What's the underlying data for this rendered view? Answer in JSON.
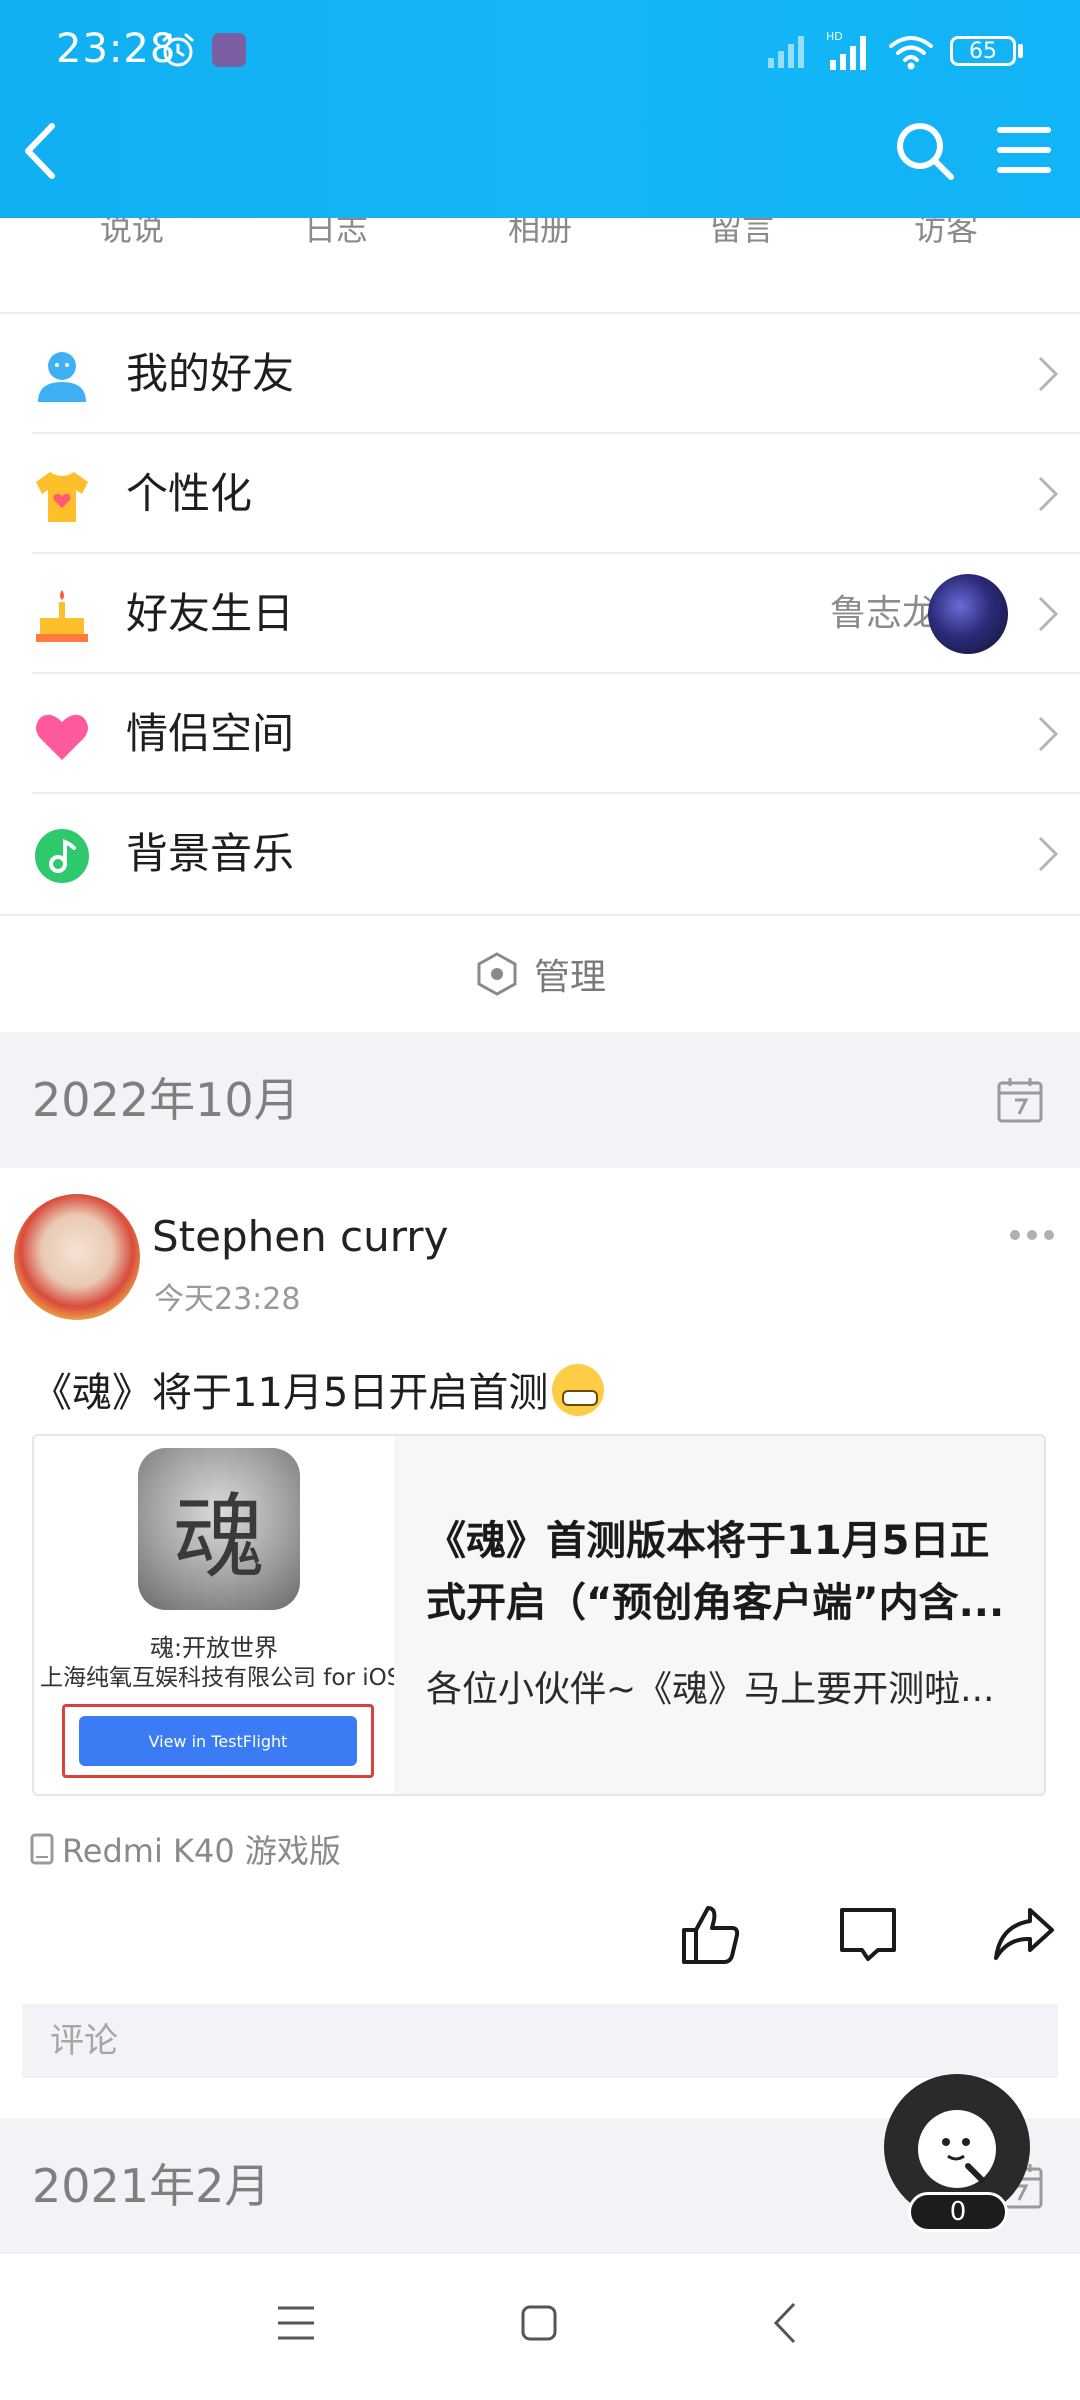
{
  "status_bar": {
    "time": "23:28",
    "hd_label": "HD",
    "battery": "65"
  },
  "stats": [
    {
      "value": "",
      "label": "说说"
    },
    {
      "value": "",
      "label": "日志"
    },
    {
      "value": "",
      "label": "相册"
    },
    {
      "value": "",
      "label": "留言"
    },
    {
      "value": "",
      "label": "访客"
    }
  ],
  "menu": {
    "items": [
      {
        "label": "我的好友",
        "icon": "friends-icon",
        "color": "#3fb0f4"
      },
      {
        "label": "个性化",
        "icon": "tshirt-icon",
        "color": "#ffbf2b"
      },
      {
        "label": "好友生日",
        "icon": "birthday-cake-icon",
        "color": "#ff9a1f",
        "extra": "鲁志龙"
      },
      {
        "label": "情侣空间",
        "icon": "heart-icon",
        "color": "#ff5a9e"
      },
      {
        "label": "背景音乐",
        "icon": "music-icon",
        "color": "#2ec96d"
      }
    ],
    "manage_label": "管理"
  },
  "sections": [
    {
      "title": "2022年10月"
    },
    {
      "title": "2021年2月"
    }
  ],
  "post": {
    "author": "Stephen curry",
    "time": "今天23:28",
    "text": "《魂》将于11月5日开启首测",
    "share": {
      "logo_char": "魂",
      "app_name": "魂:开放世界",
      "company": "上海纯氧互娱科技有限公司 for iOS",
      "button": "View in TestFlight",
      "title": "《魂》首测版本将于11月5日正式开启（“预创角客户端”内含...",
      "desc": "各位小伙伴~《魂》马上要开测啦..."
    },
    "device": "Redmi K40 游戏版",
    "comment_placeholder": "评论"
  },
  "floating": {
    "count": "0"
  },
  "colors": {
    "header": "#12b3f4",
    "accent_red": "#d9413a",
    "testflight_blue": "#3b7cf5"
  }
}
